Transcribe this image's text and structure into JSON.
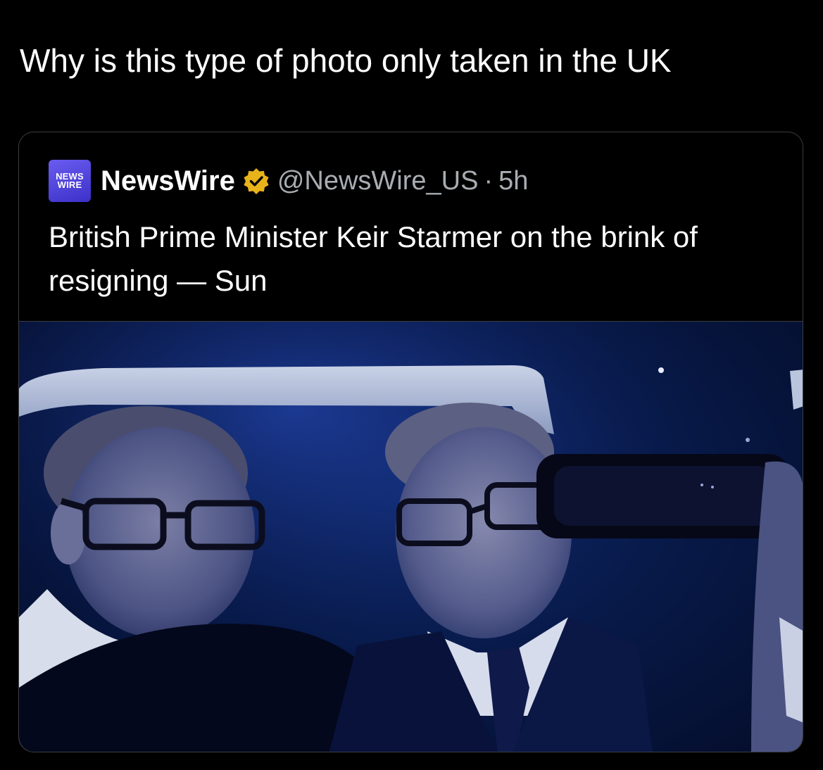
{
  "post": {
    "text": "Why is this type of photo only taken in the UK"
  },
  "quoted_post": {
    "avatar": {
      "line1": "NEWS",
      "line2": "WIRE",
      "icon": "newswire-logo"
    },
    "display_name": "NewsWire",
    "verified_icon": "verified-badge-icon",
    "handle": "@NewsWire_US",
    "separator": "·",
    "time": "5h",
    "text": "British Prime Minister Keir Starmer on the brink of resigning — Sun",
    "image": {
      "icon": "photo-two-men-in-car-at-night"
    }
  },
  "colors": {
    "background": "#000000",
    "text_primary": "#ffffff",
    "text_secondary": "#a9adb2",
    "border": "#3a3d41",
    "verified_gold": "#e8b21a",
    "avatar_purple": "#4c3fe0"
  }
}
